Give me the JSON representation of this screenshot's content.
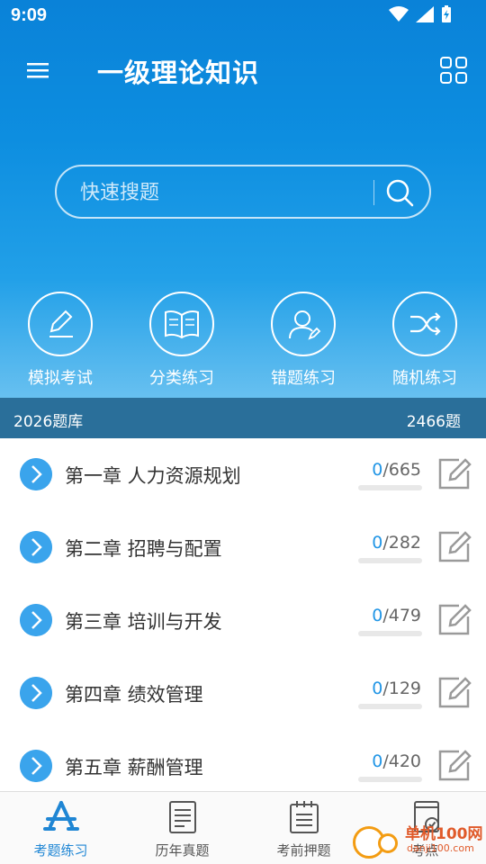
{
  "status": {
    "time": "9:09"
  },
  "appbar": {
    "title": "一级理论知识"
  },
  "search": {
    "placeholder": "快速搜题"
  },
  "quick_actions": [
    {
      "label": "模拟考试",
      "icon": "pencil-icon"
    },
    {
      "label": "分类练习",
      "icon": "book-icon"
    },
    {
      "label": "错题练习",
      "icon": "user-edit-icon"
    },
    {
      "label": "随机练习",
      "icon": "shuffle-icon"
    }
  ],
  "bank": {
    "name": "2026题库",
    "count": "2466题"
  },
  "chapters": [
    {
      "title": "第一章 人力资源规划",
      "done": "0",
      "total": "/665",
      "progress": 0
    },
    {
      "title": "第二章 招聘与配置",
      "done": "0",
      "total": "/282",
      "progress": 0
    },
    {
      "title": "第三章 培训与开发",
      "done": "0",
      "total": "/479",
      "progress": 0
    },
    {
      "title": "第四章 绩效管理",
      "done": "0",
      "total": "/129",
      "progress": 0
    },
    {
      "title": "第五章 薪酬管理",
      "done": "0",
      "total": "/420",
      "progress": 0
    }
  ],
  "bottom_nav": [
    {
      "label": "考题练习",
      "active": true,
      "icon": "app-store-icon"
    },
    {
      "label": "历年真题",
      "active": false,
      "icon": "document-icon"
    },
    {
      "label": "考前押题",
      "active": false,
      "icon": "notepad-icon"
    },
    {
      "label": "考点",
      "active": false,
      "icon": "book-check-icon"
    }
  ],
  "watermark": {
    "text": "单机100网",
    "sub": "danji100.com"
  },
  "colors": {
    "primary": "#0d8ee0",
    "accent": "#2296e6",
    "bank_bar": "#2a6f9a"
  }
}
